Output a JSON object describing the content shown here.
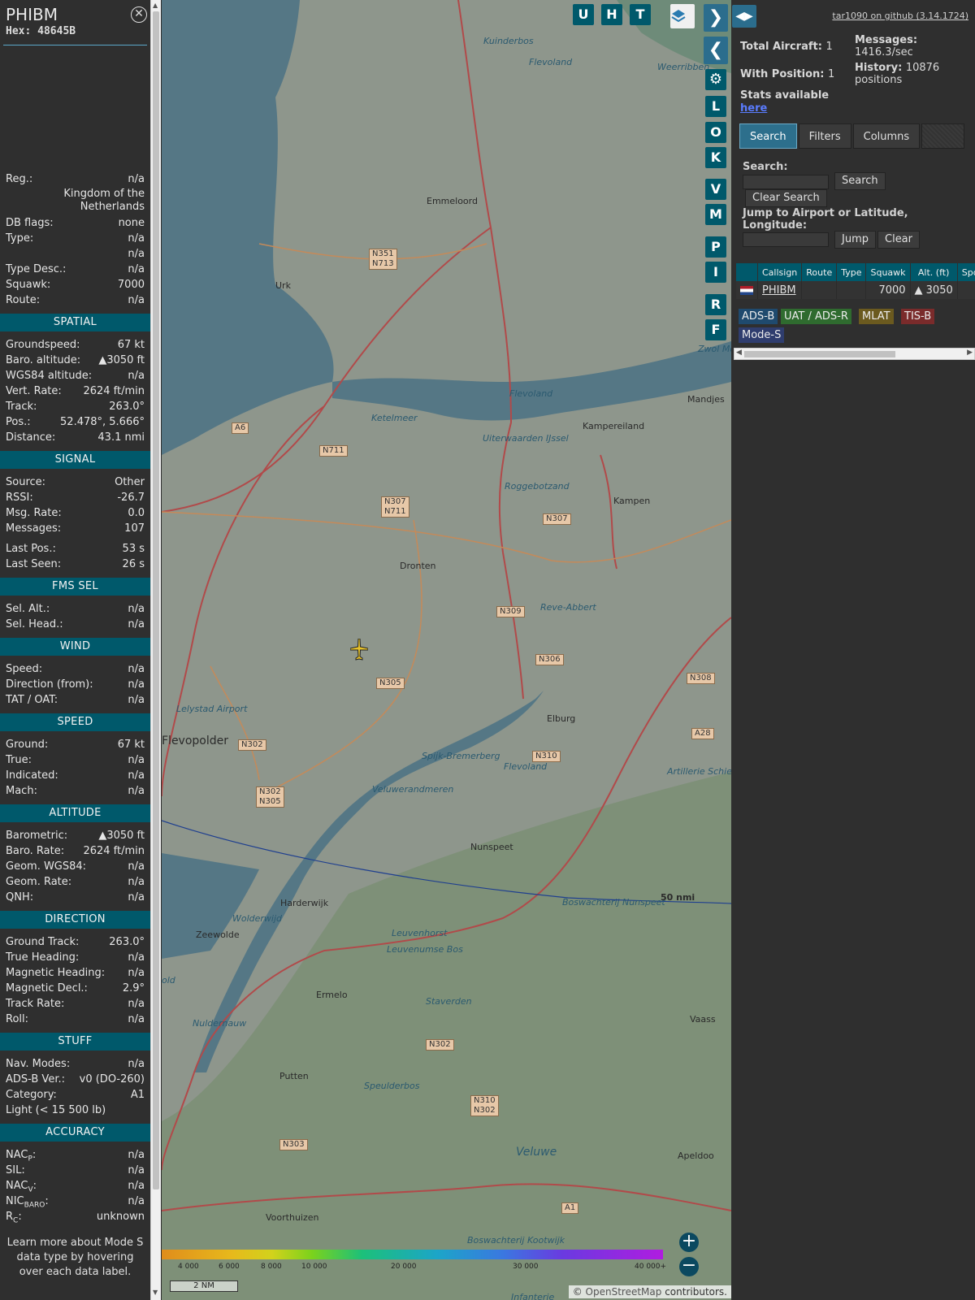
{
  "info": {
    "callsign": "PHIBM",
    "hex_label": "Hex:",
    "hex": "48645B",
    "close_icon": "close-icon",
    "top_rows": [
      {
        "k": "Reg.:",
        "v": "n/a"
      },
      {
        "k": "",
        "v": "Kingdom of the Netherlands"
      },
      {
        "k": "DB flags:",
        "v": "none"
      },
      {
        "k": "Type:",
        "v": "n/a"
      },
      {
        "k": "",
        "v": "n/a"
      },
      {
        "k": "Type Desc.:",
        "v": "n/a"
      },
      {
        "k": "Squawk:",
        "v": "7000"
      },
      {
        "k": "Route:",
        "v": "n/a"
      }
    ],
    "sections": [
      {
        "title": "SPATIAL",
        "rows": [
          {
            "k": "Groundspeed:",
            "v": "67 kt"
          },
          {
            "k": "Baro. altitude:",
            "v": "▲3050 ft"
          },
          {
            "k": "WGS84 altitude:",
            "v": "n/a"
          },
          {
            "k": "Vert. Rate:",
            "v": "2624 ft/min"
          },
          {
            "k": "Track:",
            "v": "263.0°"
          },
          {
            "k": "Pos.:",
            "v": "52.478°, 5.666°"
          },
          {
            "k": "Distance:",
            "v": "43.1 nmi"
          }
        ]
      },
      {
        "title": "SIGNAL",
        "rows": [
          {
            "k": "Source:",
            "v": "Other"
          },
          {
            "k": "RSSI:",
            "v": "-26.7"
          },
          {
            "k": "Msg. Rate:",
            "v": "0.0"
          },
          {
            "k": "Messages:",
            "v": "107"
          },
          {
            "k": "Last Pos.:",
            "v": "53 s"
          },
          {
            "k": "Last Seen:",
            "v": "26 s"
          }
        ]
      },
      {
        "title": "FMS SEL",
        "rows": [
          {
            "k": "Sel. Alt.:",
            "v": "n/a"
          },
          {
            "k": "Sel. Head.:",
            "v": "n/a"
          }
        ]
      },
      {
        "title": "WIND",
        "rows": [
          {
            "k": "Speed:",
            "v": "n/a"
          },
          {
            "k": "Direction (from):",
            "v": "n/a"
          },
          {
            "k": "TAT / OAT:",
            "v": "n/a"
          }
        ]
      },
      {
        "title": "SPEED",
        "rows": [
          {
            "k": "Ground:",
            "v": "67 kt"
          },
          {
            "k": "True:",
            "v": "n/a"
          },
          {
            "k": "Indicated:",
            "v": "n/a"
          },
          {
            "k": "Mach:",
            "v": "n/a"
          }
        ]
      },
      {
        "title": "ALTITUDE",
        "rows": [
          {
            "k": "Barometric:",
            "v": "▲3050 ft"
          },
          {
            "k": "Baro. Rate:",
            "v": "2624 ft/min"
          },
          {
            "k": "Geom. WGS84:",
            "v": "n/a"
          },
          {
            "k": "Geom. Rate:",
            "v": "n/a"
          },
          {
            "k": "QNH:",
            "v": "n/a"
          }
        ]
      },
      {
        "title": "DIRECTION",
        "rows": [
          {
            "k": "Ground Track:",
            "v": "263.0°"
          },
          {
            "k": "True Heading:",
            "v": "n/a"
          },
          {
            "k": "Magnetic Heading:",
            "v": "n/a"
          },
          {
            "k": "Magnetic Decl.:",
            "v": "2.9°"
          },
          {
            "k": "Track Rate:",
            "v": "n/a"
          },
          {
            "k": "Roll:",
            "v": "n/a"
          }
        ]
      },
      {
        "title": "STUFF",
        "rows": [
          {
            "k": "Nav. Modes:",
            "v": "n/a"
          },
          {
            "k": "ADS-B Ver.:",
            "v": "v0 (DO-260)"
          },
          {
            "k": "Category:",
            "v": "A1"
          },
          {
            "k": "Light (< 15 500 lb)",
            "v": ""
          }
        ]
      },
      {
        "title": "ACCURACY",
        "rows": [
          {
            "k": "NACP:",
            "v": "n/a"
          },
          {
            "k": "SIL:",
            "v": "n/a"
          },
          {
            "k": "NACV:",
            "v": "n/a"
          },
          {
            "k": "NICBARO:",
            "v": "n/a"
          },
          {
            "k": "RC:",
            "v": "unknown"
          }
        ]
      }
    ],
    "footer_note": "Learn more about Mode S data type by hovering over each data label."
  },
  "map": {
    "buttons_top": [
      "U",
      "H",
      "T"
    ],
    "buttons_side": [
      "L",
      "O",
      "K",
      "V",
      "M",
      "P",
      "I",
      "R",
      "F"
    ],
    "place_labels": [
      "Kuinderbos",
      "Flevoland",
      "Weerribben",
      "Emmeloord",
      "Urk",
      "Ketelmeer",
      "Flevoland",
      "Uiterwaarden IJssel",
      "Kampereiland",
      "Mandjes",
      "Roggebotzand",
      "Kampen",
      "Dronten",
      "Reve-Abbert",
      "Lelystad Airport",
      "Flevopolder",
      "Elburg",
      "Spijk-Bremerberg",
      "Flevoland",
      "Artillerie Schietkamp",
      "Veluwerandmeren",
      "Nunspeet",
      "Boswachterij Nunspeet",
      "Harderwijk",
      "Zeewolde",
      "Wolderwijd",
      "Leuvenhorst",
      "Leuvenumse Bos",
      "Ermelo",
      "Staverden",
      "Vaass",
      "Nuldernauw",
      "Putten",
      "Speulderbos",
      "Veluwe",
      "Apeldoo",
      "Voorthuizen",
      "Boswachterij Kootwijk",
      "Infanterie",
      "Zwol Meer",
      "old"
    ],
    "road_shields": [
      "N351 N713",
      "A6",
      "N711",
      "N307 N711",
      "N307",
      "N309",
      "N306",
      "N305",
      "N308",
      "A28",
      "N302",
      "N310",
      "N302 N305",
      "N302",
      "N310 N302",
      "N303",
      "A1"
    ],
    "ring_label": "50 nmi",
    "altitude_ticks": [
      "4 000",
      "6 000",
      "8 000",
      "10 000",
      "20 000",
      "30 000",
      "40 000+"
    ],
    "scale_label": "2 NM",
    "attribution_prefix": "© ",
    "attribution_link": "OpenStreetMap",
    "attribution_suffix": " contributors.",
    "layers_icon": "layers-icon",
    "settings_icon": "gear-icon",
    "aircraft_icon": "airplane-icon",
    "zoom_in": "+",
    "zoom_out": "−"
  },
  "sidebar": {
    "github_link": "tar1090 on github (3.14.1724)",
    "total_aircraft_label": "Total Aircraft:",
    "total_aircraft": "1",
    "with_position_label": "With Position:",
    "with_position": "1",
    "stats_label": "Stats available",
    "stats_link": "here",
    "messages_label": "Messages:",
    "messages_value": "1416.3/sec",
    "history_label": "History:",
    "history_value": "10876 positions",
    "tabs": [
      "Search",
      "Filters",
      "Columns"
    ],
    "search_label": "Search:",
    "search_button": "Search",
    "clear_search_button": "Clear Search",
    "jump_label": "Jump to Airport or Latitude, Longitude:",
    "jump_button": "Jump",
    "clear_button": "Clear",
    "table_headers": [
      "",
      "Callsign",
      "Route",
      "Type",
      "Squawk",
      "Alt. (ft)",
      "Spd"
    ],
    "table_rows": [
      {
        "flag": "netherlands-flag",
        "callsign": "PHIBM",
        "route": "",
        "type": "",
        "squawk": "7000",
        "alt": "▲ 3050",
        "spd": ""
      }
    ],
    "source_badges": [
      {
        "label": "ADS-B",
        "color": "#1f4a6e"
      },
      {
        "label": "UAT / ADS-R",
        "color": "#2f6b2f"
      },
      {
        "label": "MLAT",
        "color": "#6b5a1f"
      },
      {
        "label": "TIS-B",
        "color": "#7a2b2b"
      },
      {
        "label": "Mode-S",
        "color": "#2f3d6e"
      }
    ]
  }
}
